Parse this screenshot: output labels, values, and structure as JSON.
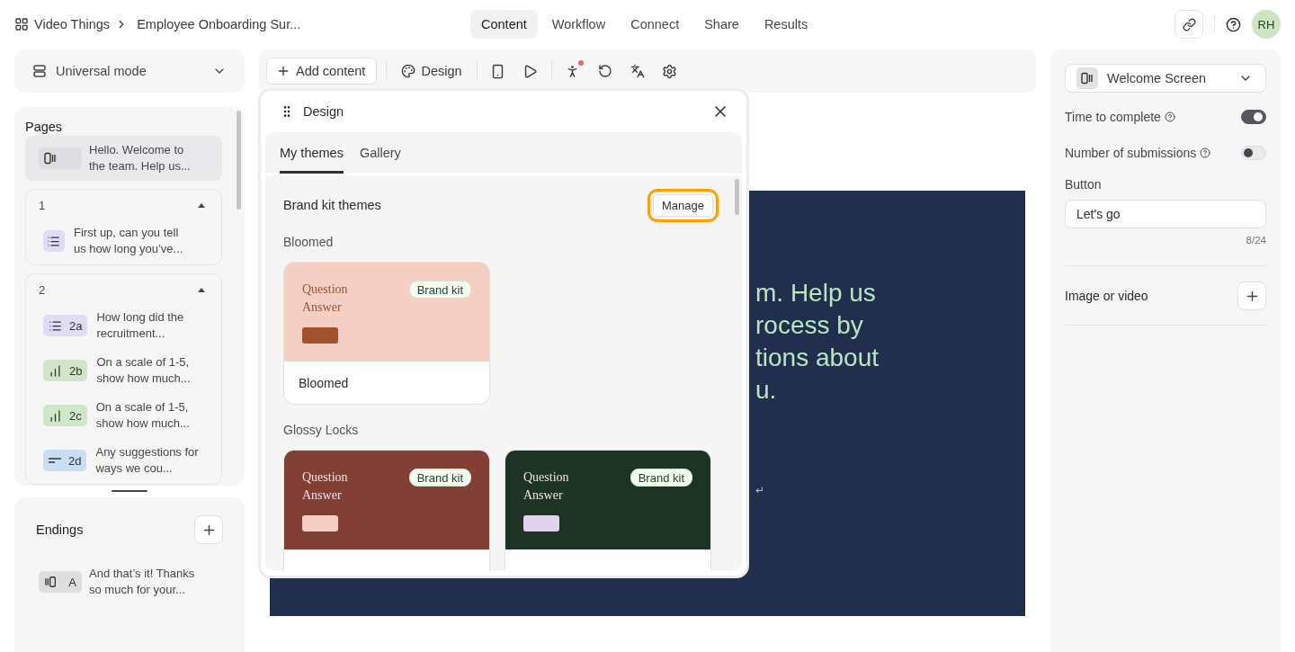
{
  "breadcrumb": {
    "workspace": "Video Things",
    "survey": "Employee Onboarding Sur..."
  },
  "nav_tabs": [
    {
      "label": "Content",
      "selected": true
    },
    {
      "label": "Workflow",
      "selected": false
    },
    {
      "label": "Connect",
      "selected": false
    },
    {
      "label": "Share",
      "selected": false
    },
    {
      "label": "Results",
      "selected": false
    }
  ],
  "avatar": "RH",
  "mode_selector": {
    "label": "Universal mode"
  },
  "pages": {
    "title": "Pages",
    "welcome": {
      "kind": "welcome",
      "text": "Hello. Welcome to the team. Help us...",
      "selected": true
    },
    "groups": [
      {
        "number": "1",
        "expanded": true,
        "items": [
          {
            "kind": "choice",
            "text": "First up, can you tell us how long you’ve..."
          }
        ]
      },
      {
        "number": "2",
        "expanded": true,
        "items": [
          {
            "kind": "choice",
            "code": "2a",
            "text": "How long did the recruitment..."
          },
          {
            "kind": "rating",
            "code": "2b",
            "text": "On a scale of 1-5, show how much..."
          },
          {
            "kind": "rating",
            "code": "2c",
            "text": "On a scale of 1-5, show how much..."
          },
          {
            "kind": "text",
            "code": "2d",
            "text": "Any suggestions for ways we cou..."
          }
        ]
      }
    ]
  },
  "endings": {
    "title": "Endings",
    "items": [
      {
        "kind": "ending",
        "code": "A",
        "text": "And that’s it! Thanks so much for your..."
      }
    ]
  },
  "toolbar": {
    "add_button": "Add content",
    "design_button": "Design",
    "accessibility_alert": true
  },
  "design_panel": {
    "title": "Design",
    "tabs": [
      {
        "label": "My themes",
        "selected": true
      },
      {
        "label": "Gallery",
        "selected": false
      }
    ],
    "section_title": "Brand kit themes",
    "manage_button": {
      "label": "Manage",
      "highlighted": true
    },
    "groups": [
      {
        "name": "Bloomed",
        "themes": [
          {
            "question": "Question",
            "answer": "Answer",
            "badge": "Brand kit",
            "name": "Bloomed",
            "color": "#f5cec4",
            "swatch": {
              "color": "#a0522d"
            }
          }
        ]
      },
      {
        "name": "Glossy Locks",
        "themes": [
          {
            "question": "Question",
            "answer": "Answer",
            "badge": "Brand kit",
            "color": "#823f36",
            "swatch": {
              "color": "#f5cec4"
            }
          },
          {
            "question": "Question",
            "answer": "Answer",
            "badge": "Brand kit",
            "color": "#1c3325",
            "swatch": {
              "color": "#e2d2f0"
            }
          }
        ]
      }
    ]
  },
  "preview": {
    "lines": [
      "m. Help us",
      "rocess by",
      "tions about",
      "u."
    ],
    "hint": "↵"
  },
  "settings": {
    "screen_type": "Welcome Screen",
    "toggles": [
      {
        "label": "Time to complete",
        "on": true
      },
      {
        "label": "Number of submissions",
        "on": false
      }
    ],
    "button_field": {
      "label": "Button",
      "value": "Let's go",
      "counter": "8/24"
    },
    "media": {
      "label": "Image or video"
    }
  }
}
